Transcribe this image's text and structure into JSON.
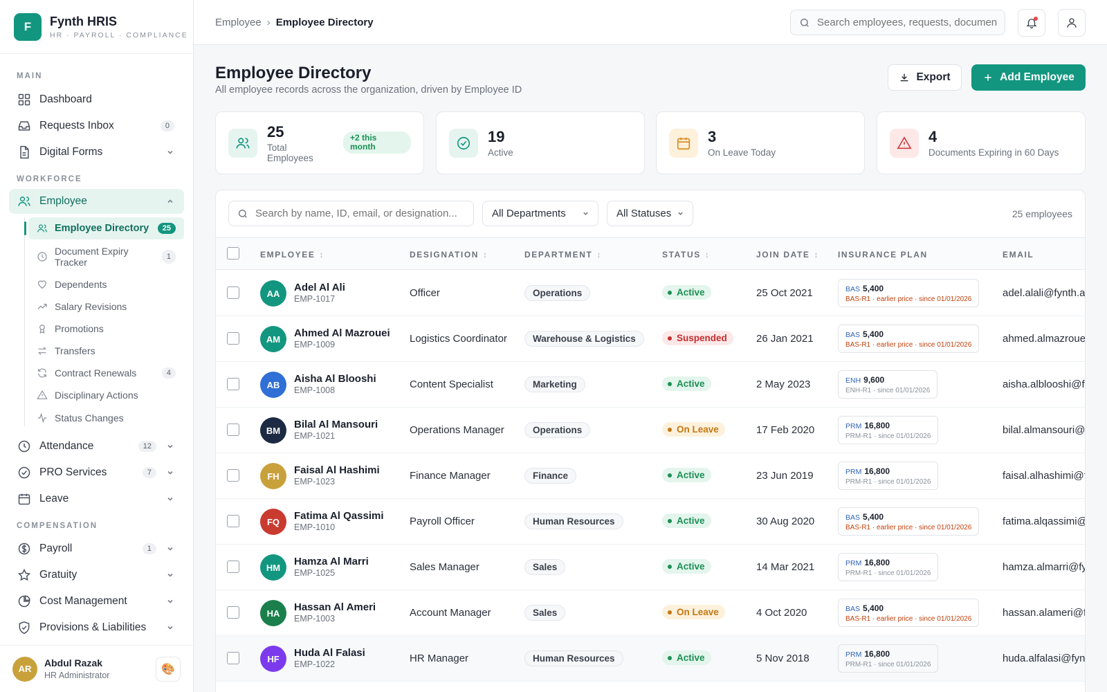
{
  "brand": {
    "logo_letter": "F",
    "name": "Fynth HRIS",
    "tagline": "HR · PAYROLL · COMPLIANCE",
    "accent": "#13967f"
  },
  "sidebar": {
    "sections": {
      "main": "MAIN",
      "workforce": "WORKFORCE",
      "compensation": "COMPENSATION"
    },
    "items": {
      "dashboard": {
        "label": "Dashboard",
        "icon": "grid-icon"
      },
      "requests": {
        "label": "Requests Inbox",
        "count": "0",
        "icon": "inbox-icon"
      },
      "forms": {
        "label": "Digital Forms",
        "icon": "file-icon"
      },
      "employee": {
        "label": "Employee",
        "icon": "users-icon"
      },
      "attendance": {
        "label": "Attendance",
        "count": "12",
        "icon": "clock-icon"
      },
      "pro": {
        "label": "PRO Services",
        "count": "7",
        "icon": "check-circle-icon"
      },
      "leave": {
        "label": "Leave",
        "icon": "calendar-icon"
      },
      "payroll": {
        "label": "Payroll",
        "count": "1",
        "icon": "dollar-icon"
      },
      "gratuity": {
        "label": "Gratuity",
        "icon": "star-icon"
      },
      "cost": {
        "label": "Cost Management",
        "icon": "pie-chart-icon"
      },
      "provisions": {
        "label": "Provisions & Liabilities",
        "icon": "shield-icon"
      }
    },
    "employee_sub": [
      {
        "label": "Employee Directory",
        "count": "25"
      },
      {
        "label": "Document Expiry Tracker",
        "count": "1"
      },
      {
        "label": "Dependents"
      },
      {
        "label": "Salary Revisions"
      },
      {
        "label": "Promotions"
      },
      {
        "label": "Transfers"
      },
      {
        "label": "Contract Renewals",
        "count": "4"
      },
      {
        "label": "Disciplinary Actions"
      },
      {
        "label": "Status Changes"
      }
    ],
    "user": {
      "initials": "AR",
      "name": "Abdul Razak",
      "role": "HR Administrator",
      "theme_icon": "🎨"
    }
  },
  "topbar": {
    "breadcrumb": [
      "Employee",
      "Employee Directory"
    ],
    "search_placeholder": "Search employees, requests, documents..."
  },
  "page": {
    "title": "Employee Directory",
    "subtitle": "All employee records across the organization, driven by Employee ID",
    "export_label": "Export",
    "add_label": "Add Employee"
  },
  "stats": [
    {
      "value": "25",
      "label": "Total Employees",
      "badge": "+2 this month",
      "icon": "users-icon"
    },
    {
      "value": "19",
      "label": "Active",
      "icon": "check-circle-icon"
    },
    {
      "value": "3",
      "label": "On Leave Today",
      "icon": "calendar-icon"
    },
    {
      "value": "4",
      "label": "Documents Expiring in 60 Days",
      "icon": "alert-triangle-icon"
    }
  ],
  "filters": {
    "search_placeholder": "Search by name, ID, email, or designation...",
    "department": "All Departments",
    "status": "All Statuses",
    "count_label": "25 employees"
  },
  "table": {
    "columns": [
      "EMPLOYEE",
      "DESIGNATION",
      "DEPARTMENT",
      "STATUS",
      "JOIN DATE",
      "INSURANCE PLAN",
      "EMAIL"
    ],
    "rows": [
      {
        "initials": "AA",
        "color": "#13967f",
        "name": "Adel Al Ali",
        "id": "EMP-1017",
        "designation": "Officer",
        "department": "Operations",
        "status": "Active",
        "status_type": "active",
        "join": "25 Oct 2021",
        "ins_code": "BAS",
        "ins_amount": "5,400",
        "ins_note": "BAS-R1 · earlier price · since 01/01/2026",
        "ins_warn": true,
        "email": "adel.alali@fynth.ae"
      },
      {
        "initials": "AM",
        "color": "#13967f",
        "name": "Ahmed Al Mazrouei",
        "id": "EMP-1009",
        "designation": "Logistics Coordinator",
        "department": "Warehouse & Logistics",
        "status": "Suspended",
        "status_type": "susp",
        "join": "26 Jan 2021",
        "ins_code": "BAS",
        "ins_amount": "5,400",
        "ins_note": "BAS-R1 · earlier price · since 01/01/2026",
        "ins_warn": true,
        "email": "ahmed.almazrouei@fynth.ae"
      },
      {
        "initials": "AB",
        "color": "#2f6fd6",
        "name": "Aisha Al Blooshi",
        "id": "EMP-1008",
        "designation": "Content Specialist",
        "department": "Marketing",
        "status": "Active",
        "status_type": "active",
        "join": "2 May 2023",
        "ins_code": "ENH",
        "ins_amount": "9,600",
        "ins_note": "ENH-R1 · since 01/01/2026",
        "ins_warn": false,
        "email": "aisha.alblooshi@fynth.ae"
      },
      {
        "initials": "BM",
        "color": "#1c2a44",
        "name": "Bilal Al Mansouri",
        "id": "EMP-1021",
        "designation": "Operations Manager",
        "department": "Operations",
        "status": "On Leave",
        "status_type": "leave",
        "join": "17 Feb 2020",
        "ins_code": "PRM",
        "ins_amount": "16,800",
        "ins_note": "PRM-R1 · since 01/01/2026",
        "ins_warn": false,
        "email": "bilal.almansouri@fynth.ae"
      },
      {
        "initials": "FH",
        "color": "#c9a13b",
        "name": "Faisal Al Hashimi",
        "id": "EMP-1023",
        "designation": "Finance Manager",
        "department": "Finance",
        "status": "Active",
        "status_type": "active",
        "join": "23 Jun 2019",
        "ins_code": "PRM",
        "ins_amount": "16,800",
        "ins_note": "PRM-R1 · since 01/01/2026",
        "ins_warn": false,
        "email": "faisal.alhashimi@fynth.ae"
      },
      {
        "initials": "FQ",
        "color": "#c93a2f",
        "name": "Fatima Al Qassimi",
        "id": "EMP-1010",
        "designation": "Payroll Officer",
        "department": "Human Resources",
        "status": "Active",
        "status_type": "active",
        "join": "30 Aug 2020",
        "ins_code": "BAS",
        "ins_amount": "5,400",
        "ins_note": "BAS-R1 · earlier price · since 01/01/2026",
        "ins_warn": true,
        "email": "fatima.alqassimi@fynth.ae"
      },
      {
        "initials": "HM",
        "color": "#13967f",
        "name": "Hamza Al Marri",
        "id": "EMP-1025",
        "designation": "Sales Manager",
        "department": "Sales",
        "status": "Active",
        "status_type": "active",
        "join": "14 Mar 2021",
        "ins_code": "PRM",
        "ins_amount": "16,800",
        "ins_note": "PRM-R1 · since 01/01/2026",
        "ins_warn": false,
        "email": "hamza.almarri@fynth.ae"
      },
      {
        "initials": "HA",
        "color": "#1a7f4b",
        "name": "Hassan Al Ameri",
        "id": "EMP-1003",
        "designation": "Account Manager",
        "department": "Sales",
        "status": "On Leave",
        "status_type": "leave",
        "join": "4 Oct 2020",
        "ins_code": "BAS",
        "ins_amount": "5,400",
        "ins_note": "BAS-R1 · earlier price · since 01/01/2026",
        "ins_warn": true,
        "email": "hassan.alameri@fynth.ae"
      },
      {
        "initials": "HF",
        "color": "#7c3aed",
        "name": "Huda Al Falasi",
        "id": "EMP-1022",
        "designation": "HR Manager",
        "department": "Human Resources",
        "status": "Active",
        "status_type": "active",
        "join": "5 Nov 2018",
        "ins_code": "PRM",
        "ins_amount": "16,800",
        "ins_note": "PRM-R1 · since 01/01/2026",
        "ins_warn": false,
        "email": "huda.alfalasi@fynth.ae"
      }
    ]
  }
}
